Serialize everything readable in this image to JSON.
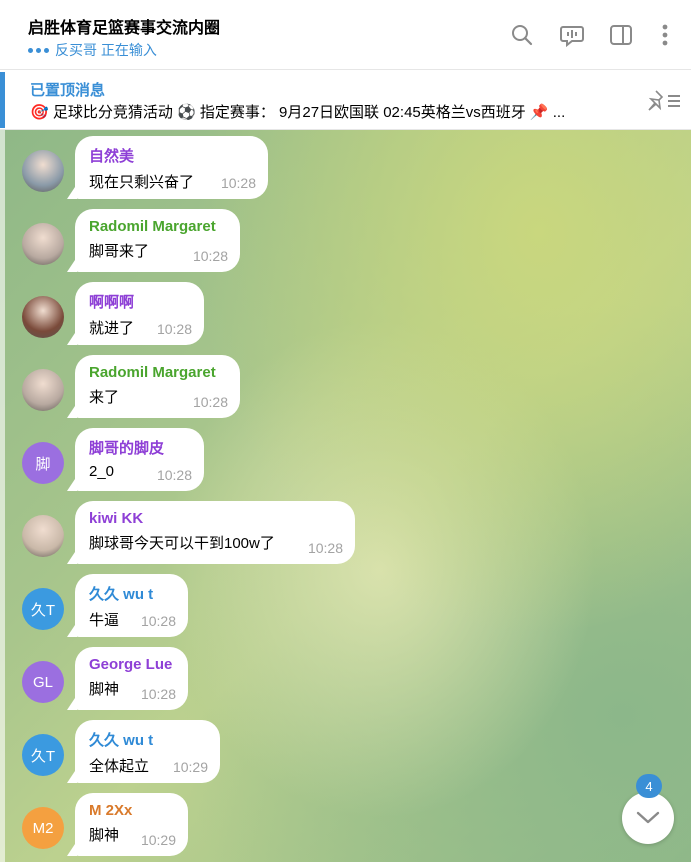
{
  "header": {
    "title": "启胜体育足篮赛事交流内圈",
    "typing_status": "反买哥 正在输入",
    "icons": [
      "search-icon",
      "chat-bubble-icon",
      "sidebar-icon",
      "more-vertical-icon"
    ]
  },
  "pinned": {
    "title": "已置顶消息",
    "text": "🎯 足球比分竞猜活动 ⚽ 指定赛事： 9月27日欧国联 02:45英格兰vs西班牙 📌 ..."
  },
  "messages": [
    {
      "sender": "自然美",
      "sender_color": "#8e3fd6",
      "text": "现在只剩兴奋了",
      "time": "10:28",
      "avatar_initials": "",
      "avatar_color": "#8a9aa8"
    },
    {
      "sender": "Radomil Margaret",
      "sender_color": "#4aa52e",
      "text": "脚哥来了",
      "time": "10:28",
      "avatar_initials": "",
      "avatar_color": "#b8a9a0"
    },
    {
      "sender": "啊啊啊",
      "sender_color": "#8e3fd6",
      "text": "就进了",
      "time": "10:28",
      "avatar_initials": "",
      "avatar_color": "#7a4a3a"
    },
    {
      "sender": "Radomil Margaret",
      "sender_color": "#4aa52e",
      "text": "来了",
      "time": "10:28",
      "avatar_initials": "",
      "avatar_color": "#b8a9a0"
    },
    {
      "sender": "脚哥的脚皮",
      "sender_color": "#8e3fd6",
      "text": "2_0",
      "time": "10:28",
      "avatar_initials": "脚",
      "avatar_color": "#9b6fe0"
    },
    {
      "sender": "kiwi KK",
      "sender_color": "#8e3fd6",
      "text": "脚球哥今天可以干到100w了",
      "time": "10:28",
      "avatar_initials": "",
      "avatar_color": "#c9b8a8"
    },
    {
      "sender": "久久 wu t",
      "sender_color": "#2f8ad6",
      "text": "牛逼",
      "time": "10:28",
      "avatar_initials": "久T",
      "avatar_color": "#3b9ae0"
    },
    {
      "sender": "George Lue",
      "sender_color": "#8e3fd6",
      "text": "脚神",
      "time": "10:28",
      "avatar_initials": "GL",
      "avatar_color": "#9b6fe0"
    },
    {
      "sender": "久久 wu t",
      "sender_color": "#2f8ad6",
      "text": "全体起立",
      "time": "10:29",
      "avatar_initials": "久T",
      "avatar_color": "#3b9ae0"
    },
    {
      "sender": "M 2Xx",
      "sender_color": "#d97a2b",
      "text": "脚神",
      "time": "10:29",
      "avatar_initials": "M2",
      "avatar_color": "#f4a040"
    }
  ],
  "scroll_down": {
    "unread_count": "4"
  }
}
